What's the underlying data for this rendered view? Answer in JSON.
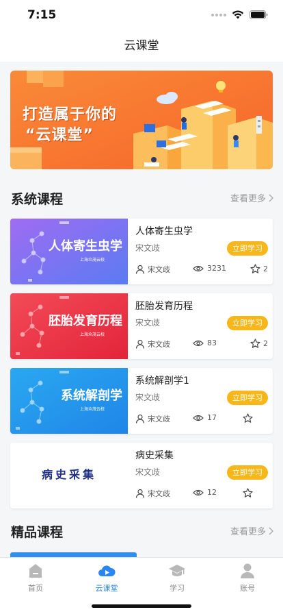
{
  "status_bar": {
    "time": "7:15"
  },
  "nav": {
    "title": "云课堂"
  },
  "banner": {
    "line1": "打造属于你的",
    "line2": "“云课堂”"
  },
  "system_section": {
    "title": "系统课程",
    "more": "查看更多"
  },
  "featured_section": {
    "title": "精品课程",
    "more": "查看更多"
  },
  "courses": [
    {
      "thumb_title": "人体寄生虫学",
      "thumb_sub": "上海众茂云校",
      "name": "人体寄生虫学",
      "teacher": "宋文歧",
      "button": "立即学习",
      "author": "宋文歧",
      "views": "3231",
      "favorites": "2"
    },
    {
      "thumb_title": "胚胎发育历程",
      "thumb_sub": "上海众茂云校",
      "name": "胚胎发育历程",
      "teacher": "宋文歧",
      "button": "立即学习",
      "author": "宋文歧",
      "views": "83",
      "favorites": "2"
    },
    {
      "thumb_title": "系统解剖学",
      "thumb_sub": "上海众茂云校",
      "name": "系统解剖学1",
      "teacher": "宋文歧",
      "button": "立即学习",
      "author": "宋文歧",
      "views": "17",
      "favorites": ""
    },
    {
      "thumb_title": "病史采集",
      "name": "病史采集",
      "teacher": "宋文歧",
      "button": "立即学习",
      "author": "宋文歧",
      "views": "12",
      "favorites": ""
    }
  ],
  "tabs": [
    {
      "label": "首页",
      "icon": "home-icon",
      "active": false
    },
    {
      "label": "云课堂",
      "icon": "cloud-play-icon",
      "active": true
    },
    {
      "label": "学习",
      "icon": "graduation-cap-icon",
      "active": false
    },
    {
      "label": "账号",
      "icon": "user-icon",
      "active": false
    }
  ],
  "colors": {
    "accent": "#2a86f0",
    "button": "#f7b61a",
    "banner": "#f7782a"
  }
}
